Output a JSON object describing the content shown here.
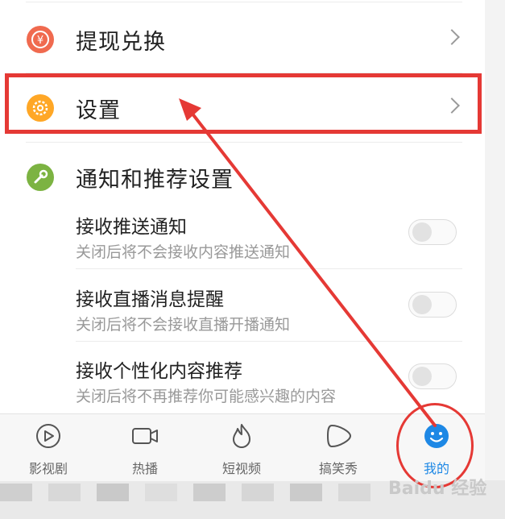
{
  "menu": {
    "withdraw_label": "提现兑换",
    "settings_label": "设置",
    "notify_section_title": "通知和推荐设置"
  },
  "options": [
    {
      "title": "接收推送通知",
      "subtitle": "关闭后将不会接收内容推送通知",
      "enabled": false
    },
    {
      "title": "接收直播消息提醒",
      "subtitle": "关闭后将不会接收直播开播通知",
      "enabled": false
    },
    {
      "title": "接收个性化内容推荐",
      "subtitle": "关闭后将不再推荐你可能感兴趣的内容",
      "enabled": false
    }
  ],
  "tabs": [
    {
      "label": "影视剧",
      "icon": "play-circle-icon"
    },
    {
      "label": "热播",
      "icon": "camera-icon"
    },
    {
      "label": "短视频",
      "icon": "flame-icon"
    },
    {
      "label": "搞笑秀",
      "icon": "play-blob-icon"
    },
    {
      "label": "我的",
      "icon": "smiley-icon",
      "active": true
    }
  ],
  "watermark": "Baidu 经验",
  "colors": {
    "highlight": "#e53935",
    "active_tab": "#1e88e5",
    "withdraw_icon": "#f06a4f",
    "settings_icon": "#ffa726",
    "notify_icon": "#7cb342"
  }
}
